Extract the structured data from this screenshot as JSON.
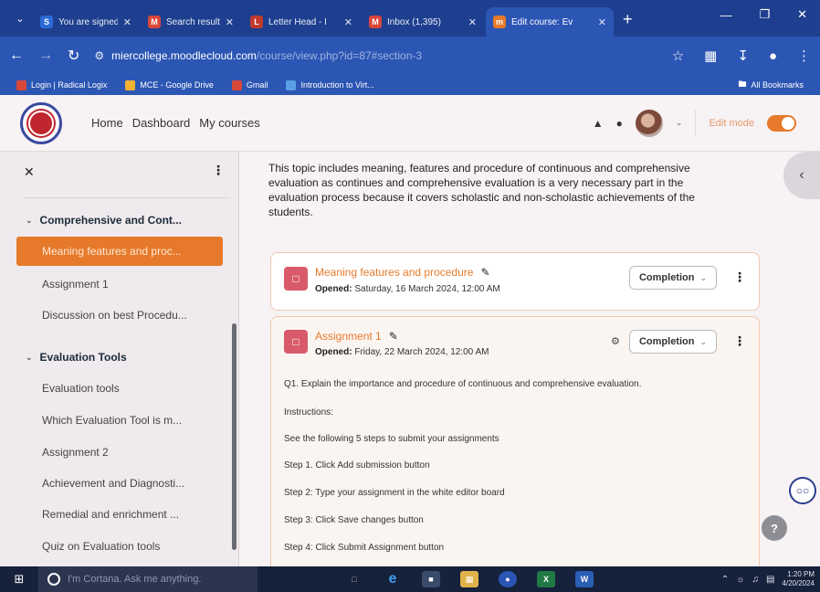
{
  "browser": {
    "tabs": [
      {
        "title": "You are signed",
        "favicon": "S",
        "color": "#2b6ad8"
      },
      {
        "title": "Search results",
        "favicon": "M",
        "color": "#d9473a"
      },
      {
        "title": "Letter Head - I",
        "favicon": "L",
        "color": "#c13a2d"
      },
      {
        "title": "Inbox (1,395)",
        "favicon": "M",
        "color": "#d9473a"
      },
      {
        "title": "Edit course: Ev",
        "favicon": "m",
        "color": "#e67a2a",
        "active": true
      }
    ],
    "url": {
      "host": "miercollege.moodlecloud.com",
      "path": "/course/view.php?id=87#section-3"
    },
    "bookmarks": [
      {
        "label": "Login | Radical Logix",
        "color": "#d9473a"
      },
      {
        "label": "MCE - Google Drive",
        "color": "#f2b233"
      },
      {
        "label": "Gmail",
        "color": "#d9473a"
      },
      {
        "label": "Introduction to Virt...",
        "color": "#5aa0e6"
      }
    ],
    "all_bookmarks": "All Bookmarks"
  },
  "header": {
    "nav": [
      "Home",
      "Dashboard",
      "My courses"
    ],
    "edit_mode_label": "Edit mode"
  },
  "sidebar": {
    "sections": [
      {
        "label": "Comprehensive and Cont..."
      },
      {
        "label": "Evaluation Tools"
      }
    ],
    "items": [
      "Meaning features and proc...",
      "Assignment 1",
      "Discussion on best Procedu...",
      "Evaluation tools",
      "Which Evaluation Tool is m...",
      "Assignment 2",
      "Achievement and Diagnosti...",
      "Remedial and enrichment ...",
      "Quiz on Evaluation tools"
    ]
  },
  "main": {
    "intro": "This topic includes meaning, features and procedure of continuous and comprehensive evaluation as continues and comprehensive evaluation is a very necessary part in the evaluation process because it covers scholastic and non-scholastic achievements of the students.",
    "activities": [
      {
        "title": "Meaning features and procedure",
        "opened_label": "Opened:",
        "opened_date": "Saturday, 16 March 2024, 12:00 AM",
        "completion": "Completion"
      },
      {
        "title": "Assignment 1",
        "opened_label": "Opened:",
        "opened_date": "Friday, 22 March 2024, 12:00 AM",
        "completion": "Completion"
      }
    ],
    "assignment_body": [
      "Q1. Explain the importance  and procedure of continuous and comprehensive evaluation.",
      "Instructions:",
      "See the following 5 steps to submit your assignments",
      "Step 1. Click Add submission button",
      "Step 2: Type your assignment in the white editor board",
      "Step 3: Click Save changes button",
      "Step 4: Click Submit Assignment button"
    ]
  },
  "taskbar": {
    "cortana": "I'm Cortana. Ask me anything.",
    "time": "1:20 PM",
    "date": "4/20/2024"
  }
}
